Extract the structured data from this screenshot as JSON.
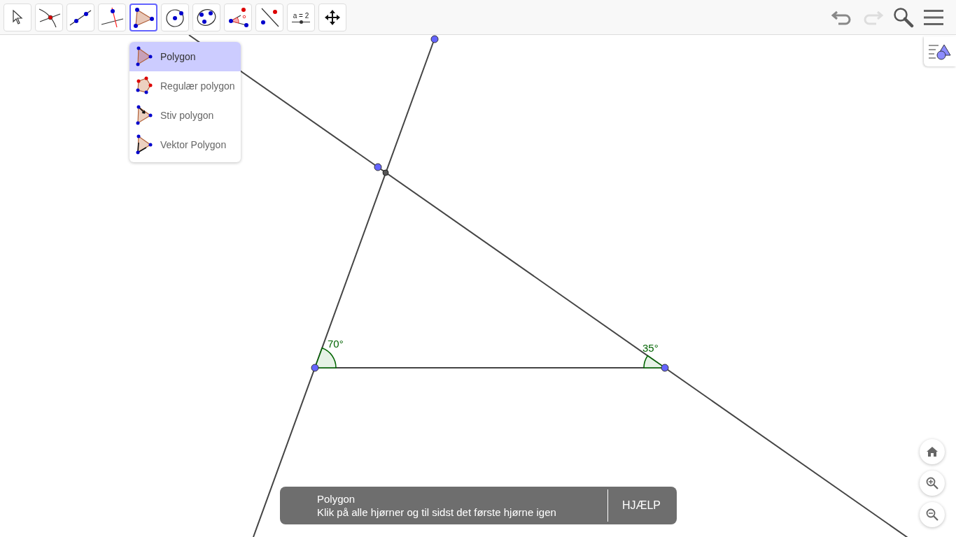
{
  "toolbar": {
    "tools": [
      {
        "kind": "move",
        "selected": false
      },
      {
        "kind": "intersect",
        "selected": false
      },
      {
        "kind": "line",
        "selected": false
      },
      {
        "kind": "perpendicular",
        "selected": false
      },
      {
        "kind": "polygon",
        "selected": true
      },
      {
        "kind": "circle",
        "selected": false
      },
      {
        "kind": "conic",
        "selected": false
      },
      {
        "kind": "angle",
        "selected": false
      },
      {
        "kind": "reflect",
        "selected": false
      },
      {
        "kind": "slider",
        "label": "a = 2",
        "selected": false
      },
      {
        "kind": "pan",
        "selected": false
      }
    ],
    "undo": {
      "disabled": false
    },
    "redo": {
      "disabled": true
    }
  },
  "tool_menu": [
    {
      "kind": "polygon",
      "label": "Polygon",
      "selected": true
    },
    {
      "kind": "regular",
      "label": "Regulær polygon",
      "selected": false
    },
    {
      "kind": "rigid",
      "label": "Stiv polygon",
      "selected": false
    },
    {
      "kind": "vector",
      "label": "Vektor Polygon",
      "selected": false
    }
  ],
  "angles": [
    {
      "label": "70°"
    },
    {
      "label": "35°"
    }
  ],
  "tooltip": {
    "title": "Polygon",
    "text": "Klik på alle hjørner og til sidst det første hjørne igen",
    "button": "HJÆLP"
  }
}
